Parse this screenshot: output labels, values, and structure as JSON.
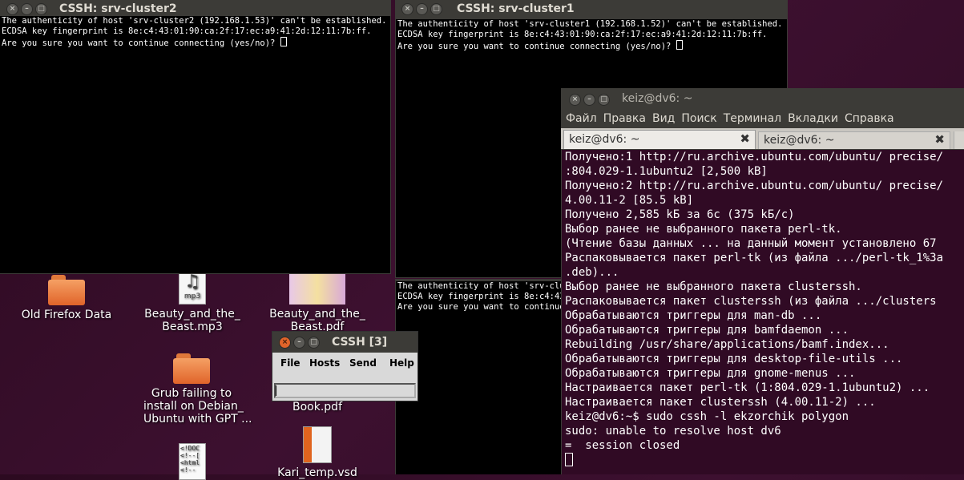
{
  "desktop": {
    "icons": [
      {
        "label": "Old Firefox Data"
      },
      {
        "label": "Beauty_and_the_\nBeast.mp3"
      },
      {
        "label": "Beauty_and_the_\nBeast.pdf"
      },
      {
        "label": "Grub failing to\ninstall on Debian_\nUbuntu with GPT ..."
      },
      {
        "label": "Book.pdf"
      },
      {
        "label": "Kari_temp.vsd"
      }
    ],
    "mp3_badge": "mp3",
    "html_preview": "<!DOC\n<!--[\n<html\n<!--"
  },
  "windows": {
    "cluster2": {
      "title": "CSSH: srv-cluster2",
      "lines": [
        "The authenticity of host 'srv-cluster2 (192.168.1.53)' can't be established.",
        "ECDSA key fingerprint is 8e:c4:43:01:90:ca:2f:17:ec:a9:41:2d:12:11:7b:ff.",
        "Are you sure you want to continue connecting (yes/no)? "
      ]
    },
    "cluster1": {
      "title": "CSSH: srv-cluster1",
      "lines": [
        "The authenticity of host 'srv-cluster1 (192.168.1.52)' can't be established.",
        "ECDSA key fingerprint is 8e:c4:43:01:90:ca:2f:17:ec:a9:41:2d:12:11:7b:ff.",
        "Are you sure you want to continue connecting (yes/no)? "
      ]
    },
    "cluster3": {
      "lines": [
        "The authenticity of host 'srv-clus",
        "ECDSA key fingerprint is 8e:c4:43:",
        "Are you sure you want to continue "
      ]
    },
    "cssh": {
      "title": "CSSH [3]",
      "menu": [
        "File",
        "Hosts",
        "Send",
        "Help"
      ],
      "input_value": ""
    },
    "terminal": {
      "title": "keiz@dv6: ~",
      "menu": [
        "Файл",
        "Правка",
        "Вид",
        "Поиск",
        "Терминал",
        "Вкладки",
        "Справка"
      ],
      "tabs": [
        {
          "label": "keiz@dv6: ~"
        },
        {
          "label": "keiz@dv6: ~"
        }
      ],
      "lines": [
        "Получено:1 http://ru.archive.ubuntu.com/ubuntu/ precise/",
        ":804.029-1.1ubuntu2 [2,500 kB]",
        "Получено:2 http://ru.archive.ubuntu.com/ubuntu/ precise/",
        "4.00.11-2 [85.5 kB]",
        "Получено 2,585 kБ за 6с (375 kБ/c)",
        "Выбор ранее не выбранного пакета perl-tk.",
        "(Чтение базы данных ... на данный момент установлено 67",
        "Распаковывается пакет perl-tk (из файла .../perl-tk_1%3a",
        ".deb)...",
        "Выбор ранее не выбранного пакета clusterssh.",
        "Распаковывается пакет clusterssh (из файла .../clusters",
        "Обрабатываются триггеры для man-db ...",
        "Обрабатываются триггеры для bamfdaemon ...",
        "Rebuilding /usr/share/applications/bamf.index...",
        "Обрабатываются триггеры для desktop-file-utils ...",
        "Обрабатываются триггеры для gnome-menus ...",
        "Настраивается пакет perl-tk (1:804.029-1.1ubuntu2) ...",
        "Настраивается пакет clusterssh (4.00.11-2) ...",
        "keiz@dv6:~$ sudo cssh -l ekzorchik polygon",
        "sudo: unable to resolve host dv6",
        "=  session closed"
      ]
    }
  },
  "colors": {
    "desktop": "#3b0d2c",
    "terminal_bg": "#300a24",
    "chrome": "#3c3b37",
    "cssh_bg": "#d9d9d9"
  }
}
